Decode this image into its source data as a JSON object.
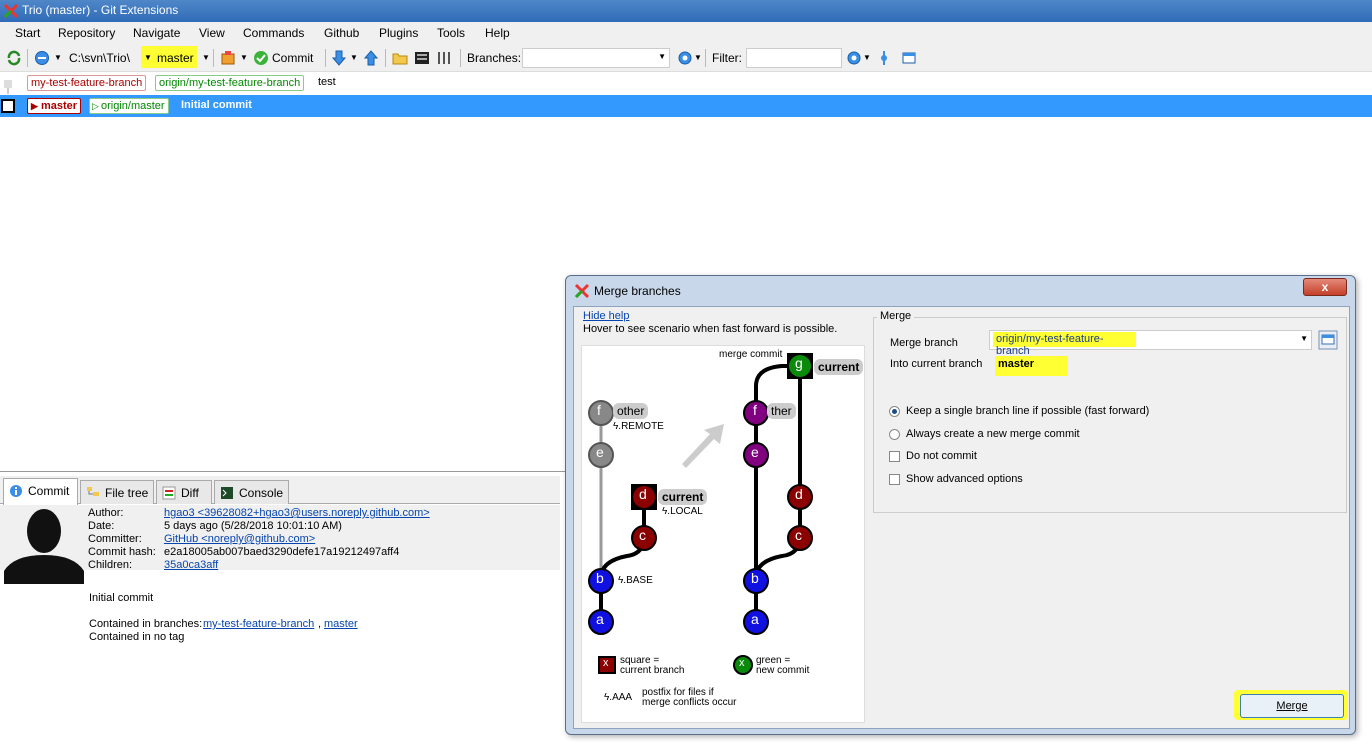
{
  "window": {
    "title": "Trio (master) - Git Extensions"
  },
  "menu": [
    "Start",
    "Repository",
    "Navigate",
    "View",
    "Commands",
    "Github",
    "Plugins",
    "Tools",
    "Help"
  ],
  "toolbar": {
    "path": "C:\\svn\\Trio\\",
    "branch": "master",
    "commit_label": "Commit",
    "branches_label": "Branches:",
    "filter_label": "Filter:"
  },
  "graph_rows": [
    {
      "tags": [
        "my-test-feature-branch",
        "origin/my-test-feature-branch"
      ],
      "message": "test"
    },
    {
      "tags": [
        "master",
        "origin/master"
      ],
      "message": "Initial commit"
    }
  ],
  "tabs": [
    "Commit",
    "File tree",
    "Diff",
    "Console"
  ],
  "commit": {
    "author_label": "Author:",
    "author": "hgao3 <39628082+hgao3@users.noreply.github.com>",
    "date_label": "Date:",
    "date": "5 days ago (5/28/2018 10:01:10 AM)",
    "committer_label": "Committer:",
    "committer": "GitHub <noreply@github.com>",
    "hash_label": "Commit hash:",
    "hash": "e2a18005ab007baed3290defe17a19212497aff4",
    "children_label": "Children:",
    "children": "35a0ca3aff",
    "message": "Initial commit",
    "branches_prefix": "Contained in branches:",
    "branch1": "my-test-feature-branch",
    "branch_sep": ",",
    "branch2": "master",
    "tags": "Contained in no tag"
  },
  "dialog": {
    "title": "Merge branches",
    "close": "x",
    "hide_help": "Hide help",
    "help_text": "Hover to see scenario when fast forward is possible.",
    "group_title": "Merge",
    "merge_branch_label": "Merge branch",
    "merge_branch_value": "origin/my-test-feature-branch",
    "into_label": "Into current branch",
    "into_value": "master",
    "opt_ff": "Keep a single branch line if possible (fast forward)",
    "opt_merge_commit": "Always create a new merge commit",
    "opt_no_commit": "Do not commit",
    "opt_advanced": "Show advanced options",
    "merge_button": "Merge"
  },
  "diagram": {
    "merge_commit": "merge commit",
    "other": "other",
    "other2": "ther",
    "remote": ".REMOTE",
    "current": "current",
    "local": ".LOCAL",
    "base": ".BASE",
    "nodes": {
      "a": "a",
      "b": "b",
      "c": "c",
      "d": "d",
      "e": "e",
      "f": "f",
      "g": "g"
    },
    "legend_x": "x",
    "legend_square1": "square =",
    "legend_square2": "current branch",
    "legend_green1": "green =",
    "legend_green2": "new commit",
    "legend_aaa": ".AAA",
    "legend_postfix1": "postfix for files if",
    "legend_postfix2": "merge conflicts occur"
  }
}
